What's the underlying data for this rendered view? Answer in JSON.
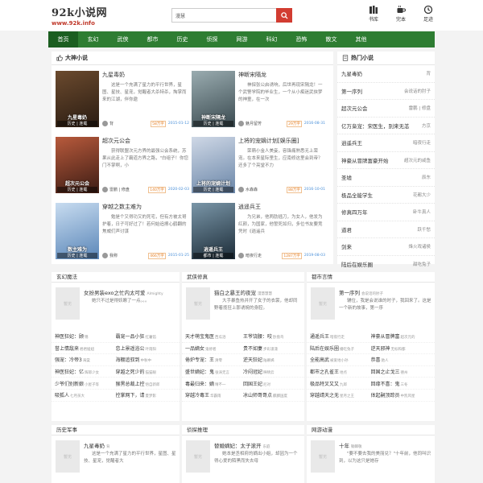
{
  "header": {
    "logo_main": "92k小说网",
    "logo_sub": "www.92k.info",
    "search_value": "漫慧",
    "icons": [
      {
        "name": "bookshelf-icon",
        "label": "书库"
      },
      {
        "name": "completed-icon",
        "label": "完本"
      },
      {
        "name": "history-icon",
        "label": "足迹"
      }
    ]
  },
  "nav": [
    "首页",
    "玄幻",
    "武侠",
    "都市",
    "历史",
    "侦探",
    "网游",
    "科幻",
    "恐怖",
    "散文",
    "其他"
  ],
  "featured": {
    "title": "大神小说",
    "books": [
      {
        "title": "九星毒奶",
        "desc": "这是一个充满了星力的平行世界，星图、星技、星宠，觉醒者大杀特杀，掏掌而来的江湖，伴你遨",
        "author": "背",
        "count": "58万字",
        "date": "2015-01-12",
        "cover_main": "九星毒奶",
        "cover_bottom": "历史 | 连载",
        "cover_color": "#3a2a1e"
      },
      {
        "title": "神断宋隔龙",
        "desc": "神探张公启诱响，后世再现宋隔龙！一个武警学院的毕业生，一个从小痴迷武侠梦的神童，在一次",
        "author": "魅月留芳",
        "count": "29万字",
        "date": "2016-08-31",
        "cover_main": "神断宋隔龙",
        "cover_bottom": "历史 | 连载",
        "cover_color": "#6a7a80"
      },
      {
        "title": "超次元公会",
        "desc": "获得联盟次元方界的最强公会系统，苏果从此走上了霸道方界之路，\"白组子！你您门不掌啊，小",
        "author": "雷鹏 | 修盘",
        "count": "140万字",
        "date": "2020-02-03",
        "cover_main": "超次元公会",
        "cover_bottom": "历史 | 连载",
        "cover_color": "#7a3c2e"
      },
      {
        "title": "上将的宠嫡计划[娱乐圈]",
        "desc": "荣萌小金人美妾，容锋痛熟悉无上荣宠。在本来星际里生，应南修这里会到帝？还多了个亮堂不力",
        "author": "水森森",
        "count": "88万字",
        "date": "2016-10-01",
        "cover_main": "上将的宠嫡计划",
        "cover_bottom": "历史 | 连载",
        "cover_color": "#8aa0b8"
      },
      {
        "title": "穿越之数主难为",
        "desc": "勉是个又得功又的死宅，但有方被太哥护着，日子可好过了！若何始追擦心鹤翻的焦威们声讨谋",
        "author": "我称",
        "count": "466万字",
        "date": "2015-01-25",
        "cover_main": "数主难为",
        "cover_bottom": "历史 | 连载",
        "cover_color": "#6e9ac9"
      },
      {
        "title": "逍遥兵王",
        "desc": "为兄弟，他两肋插刀，为女人，他发为红颜，为国家，他誓死如归，多位书友要竞凭时《逍遥兵",
        "author": "暗夜行走",
        "count": "1287万字",
        "date": "2019-08-03",
        "cover_main": "逍遥兵王",
        "cover_bottom": "都市 | 连载",
        "cover_color": "#2c4050"
      }
    ]
  },
  "hot": {
    "title": "热门小说",
    "items": [
      {
        "name": "九星毒奶",
        "author": "背"
      },
      {
        "name": "第一序列",
        "author": "会说话的肘子"
      },
      {
        "name": "超次元公会",
        "author": "雷鹏 | 修盘"
      },
      {
        "name": "亿万枭宠：宋医生，别来无恙",
        "author": "方京"
      },
      {
        "name": "逍遥兵王",
        "author": "暗夜行走"
      },
      {
        "name": "神豪从冒牌富豪开始",
        "author": "超次元的咸鱼"
      },
      {
        "name": "圣墟",
        "author": "辰东"
      },
      {
        "name": "极品全能学生",
        "author": "花都大少"
      },
      {
        "name": "修真四万年",
        "author": "卧牛真人"
      },
      {
        "name": "道君",
        "author": "跃千愁"
      },
      {
        "name": "剑来",
        "author": "烽火戏诸侯"
      },
      {
        "name": "陆后在娱乐圈",
        "author": "甜吃兔子"
      }
    ]
  },
  "cat_row1": [
    {
      "title": "玄幻魔法",
      "feat": {
        "title": "女扮男装exo之忙内太可爱",
        "author": "Almighty",
        "desc": "她只不过是得妖瞭了一点。。。",
        "cover": "暂无"
      },
      "list": [
        [
          {
            "t": "神医狂妃：顾",
            "a": "锦"
          },
          {
            "t": "霸宠一品小狂",
            "a": "红薯馅"
          }
        ],
        [
          {
            "t": "誉上情敌来",
            "a": "君君妞妞"
          },
          {
            "t": "恋上景遥浴公",
            "a": "叶雨阳"
          }
        ],
        [
          {
            "t": "强宠：冷帝3",
            "a": "海棠"
          },
          {
            "t": "海棚追驭到",
            "a": "中秋中"
          }
        ],
        [
          {
            "t": "神医狂妃：亿",
            "a": "辉耶少女"
          },
          {
            "t": "穿越之死少的",
            "a": "猫猫眼"
          }
        ],
        [
          {
            "t": "少爷们别新娘",
            "a": "小屋子等"
          },
          {
            "t": "猴黑总裁上控",
            "a": "悟自新郎"
          }
        ],
        [
          {
            "t": "吸狐人",
            "a": "七月孩大"
          },
          {
            "t": "控掌网下，请",
            "a": "夏梦影"
          }
        ]
      ]
    },
    {
      "title": "武侠修真",
      "feat": {
        "title": "猫白之暴王的夜宠",
        "author": "漫慧慧慧",
        "desc": "大手暴鱼热并开了女子的衣裳，他却同野着揽狂上那诱婉的身腔。",
        "cover": "暂无"
      },
      "list": [
        [
          {
            "t": "天才萌宝鬼医",
            "a": "西瓜浴"
          },
          {
            "t": "王爷饶腰：咬",
            "a": "卧盘鸟"
          }
        ],
        [
          {
            "t": "一品嫡女",
            "a": "鬼修者"
          },
          {
            "t": "贵不如妻",
            "a": "步彩潇潇"
          }
        ],
        [
          {
            "t": "倦炉专宠：王",
            "a": "清零"
          },
          {
            "t": "逆天狂妃",
            "a": "陆慕嫣"
          }
        ],
        [
          {
            "t": "盛世嫡妃：鬼",
            "a": "张涛无言"
          },
          {
            "t": "冷闷冠妃",
            "a": "映晴云"
          }
        ],
        [
          {
            "t": "毒最归来：嫡",
            "a": "晴不一"
          },
          {
            "t": "回国王妃",
            "a": "尼对"
          }
        ],
        [
          {
            "t": "穿越冷毒王",
            "a": "华霸雨"
          },
          {
            "t": "冰山师哥哥点",
            "a": "麒麟国度"
          }
        ]
      ]
    },
    {
      "title": "都市言情",
      "feat": {
        "title": "第一序列",
        "author": "会说话的肘子",
        "desc": "辅位，我是会说谁的时子，我回来了。这是一个新的故事，第一序",
        "cover": "暂无"
      },
      "list": [
        [
          {
            "t": "通遥兵王",
            "a": "暗夜行走"
          },
          {
            "t": "神豪从冒牌富",
            "a": "超次元的"
          }
        ],
        [
          {
            "t": "陆后在娱乐圈",
            "a": "播吃兔子"
          },
          {
            "t": "逆天邪神",
            "a": "无标和都"
          }
        ],
        [
          {
            "t": "全能高武",
            "a": "被爱地小孙"
          },
          {
            "t": "恭喜",
            "a": "驰人"
          }
        ],
        [
          {
            "t": "都市之孔雀王",
            "a": "地点"
          },
          {
            "t": "回国之止戈三",
            "a": "德州"
          }
        ],
        [
          {
            "t": "极品特叉又又",
            "a": "九郎"
          },
          {
            "t": "回缘不喜：鬼",
            "a": "三冬"
          }
        ],
        [
          {
            "t": "穿越靖天之无",
            "a": "星月之王"
          },
          {
            "t": "体起嗣顶踪员",
            "a": "中凯风星"
          }
        ]
      ]
    }
  ],
  "cat_row2": [
    {
      "title": "历史军事",
      "feat": {
        "title": "九星毒奶",
        "author": "背",
        "desc": "这是一个充满了星力的平行世界，星图、星技、星宠，觉醒者大",
        "cover": "暂无"
      }
    },
    {
      "title": "侦探推理",
      "feat": {
        "title": "替婚嫡妃：太子滚开",
        "author": "东庭",
        "desc": "她本是丞相府的嫡出小姐，却因为一个得心爱的陌黑而失去母",
        "cover": "暂无"
      }
    },
    {
      "title": "网游动漫",
      "feat": {
        "title": "十年",
        "author": "锄棘敬",
        "desc": "\"要不要去我的美丽兑？\"十年前，他同叫识到，以为这只是她存",
        "cover": "暂无"
      }
    }
  ]
}
